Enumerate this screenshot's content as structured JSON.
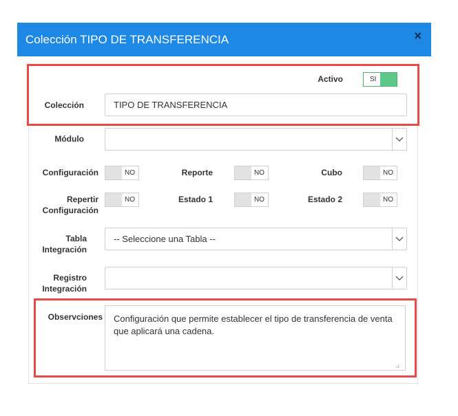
{
  "modal": {
    "title": "Colección TIPO DE TRANSFERENCIA",
    "close_label": "×"
  },
  "form": {
    "activo": {
      "label": "Activo",
      "value": "SI",
      "state": "on"
    },
    "coleccion": {
      "label": "Colección",
      "value": "TIPO DE TRANSFERENCIA"
    },
    "modulo": {
      "label": "Módulo",
      "value": ""
    },
    "configuracion": {
      "label": "Configuración",
      "value": "NO"
    },
    "reporte": {
      "label": "Reporte",
      "value": "NO"
    },
    "cubo": {
      "label": "Cubo",
      "value": "NO"
    },
    "repertir": {
      "label_line1": "Repertir",
      "label_line2": "Configuración",
      "value": "NO"
    },
    "estado1": {
      "label": "Estado 1",
      "value": "NO"
    },
    "estado2": {
      "label": "Estado 2",
      "value": "NO"
    },
    "tabla": {
      "label_line1": "Tabla",
      "label_line2": "Integración",
      "value": "-- Seleccione una Tabla --"
    },
    "registro": {
      "label_line1": "Registro",
      "label_line2": "Integración",
      "value": ""
    },
    "observaciones": {
      "label": "Observciones",
      "value": "Configuración que permite establecer el tipo de transferencia de venta que aplicará una cadena."
    }
  },
  "icons": {
    "close": "close-icon",
    "dropdown": "chevron-down-icon",
    "resize": "resize-grip-icon"
  },
  "colors": {
    "titlebar": "#1e88e5",
    "toggle_on": "#5cc98a",
    "highlight": "#e84a4a"
  }
}
